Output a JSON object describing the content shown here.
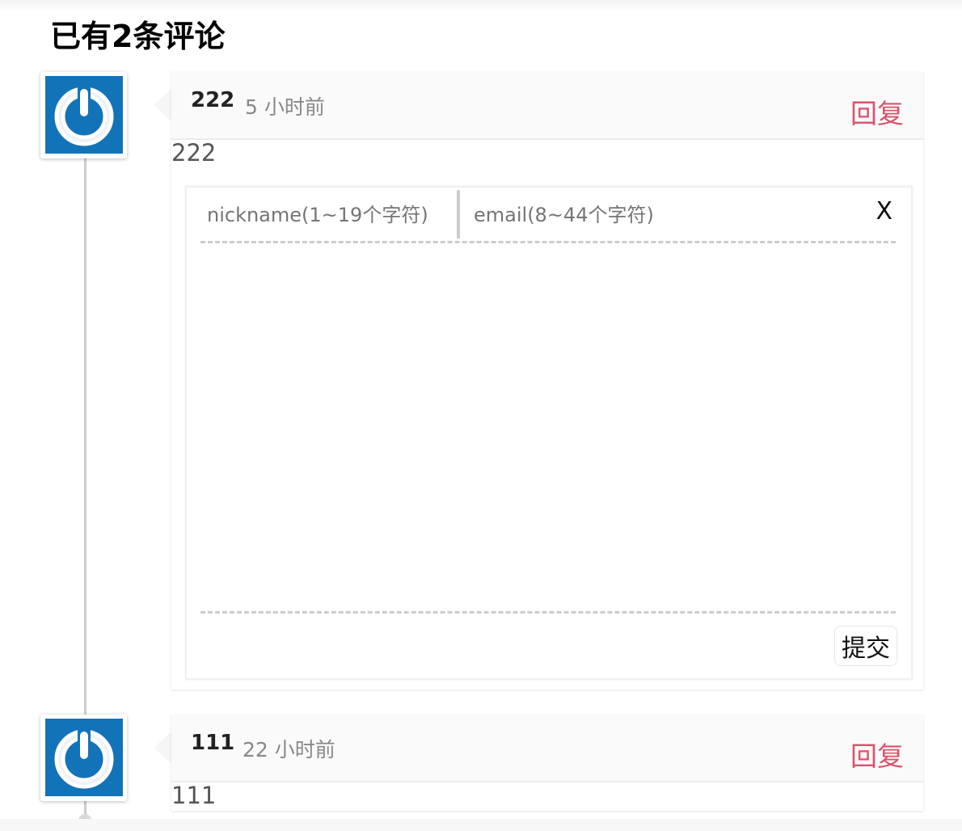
{
  "title": "已有2条评论",
  "comments": [
    {
      "author": "222",
      "time": "5 小时前",
      "reply_label": "回复",
      "content": "222"
    },
    {
      "author": "111",
      "time": "22 小时前",
      "reply_label": "回复",
      "content": "111"
    }
  ],
  "reply_form": {
    "nickname_placeholder": "nickname(1~19个字符)",
    "email_placeholder": "email(8~44个字符)",
    "close_label": "X",
    "submit_label": "提交"
  },
  "colors": {
    "avatar_bg": "#1273b9",
    "reply_link": "#d9536b"
  },
  "icons": {
    "avatar": "power-icon"
  }
}
